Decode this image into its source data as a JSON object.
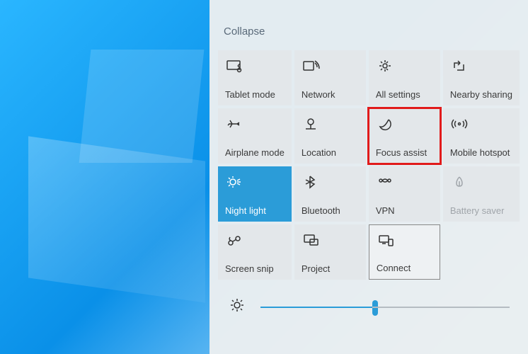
{
  "panel": {
    "collapse_label": "Collapse",
    "tiles": [
      {
        "label": "Tablet mode",
        "icon": "tablet-mode-icon"
      },
      {
        "label": "Network",
        "icon": "network-icon"
      },
      {
        "label": "All settings",
        "icon": "settings-icon"
      },
      {
        "label": "Nearby sharing",
        "icon": "nearby-sharing-icon"
      },
      {
        "label": "Airplane mode",
        "icon": "airplane-mode-icon"
      },
      {
        "label": "Location",
        "icon": "location-icon"
      },
      {
        "label": "Focus assist",
        "icon": "focus-assist-icon"
      },
      {
        "label": "Mobile hotspot",
        "icon": "mobile-hotspot-icon"
      },
      {
        "label": "Night light",
        "icon": "night-light-icon"
      },
      {
        "label": "Bluetooth",
        "icon": "bluetooth-icon"
      },
      {
        "label": "VPN",
        "icon": "vpn-icon"
      },
      {
        "label": "Battery saver",
        "icon": "battery-saver-icon"
      },
      {
        "label": "Screen snip",
        "icon": "screen-snip-icon"
      },
      {
        "label": "Project",
        "icon": "project-icon"
      },
      {
        "label": "Connect",
        "icon": "connect-icon"
      }
    ],
    "states": {
      "active_tile": "Night light",
      "disabled_tile": "Battery saver",
      "highlighted_tile": "Focus assist",
      "bordered_tile": "Connect"
    },
    "brightness_percent": 45
  },
  "colors": {
    "accent": "#2b9cd8",
    "highlight_border": "#e11b1b"
  }
}
